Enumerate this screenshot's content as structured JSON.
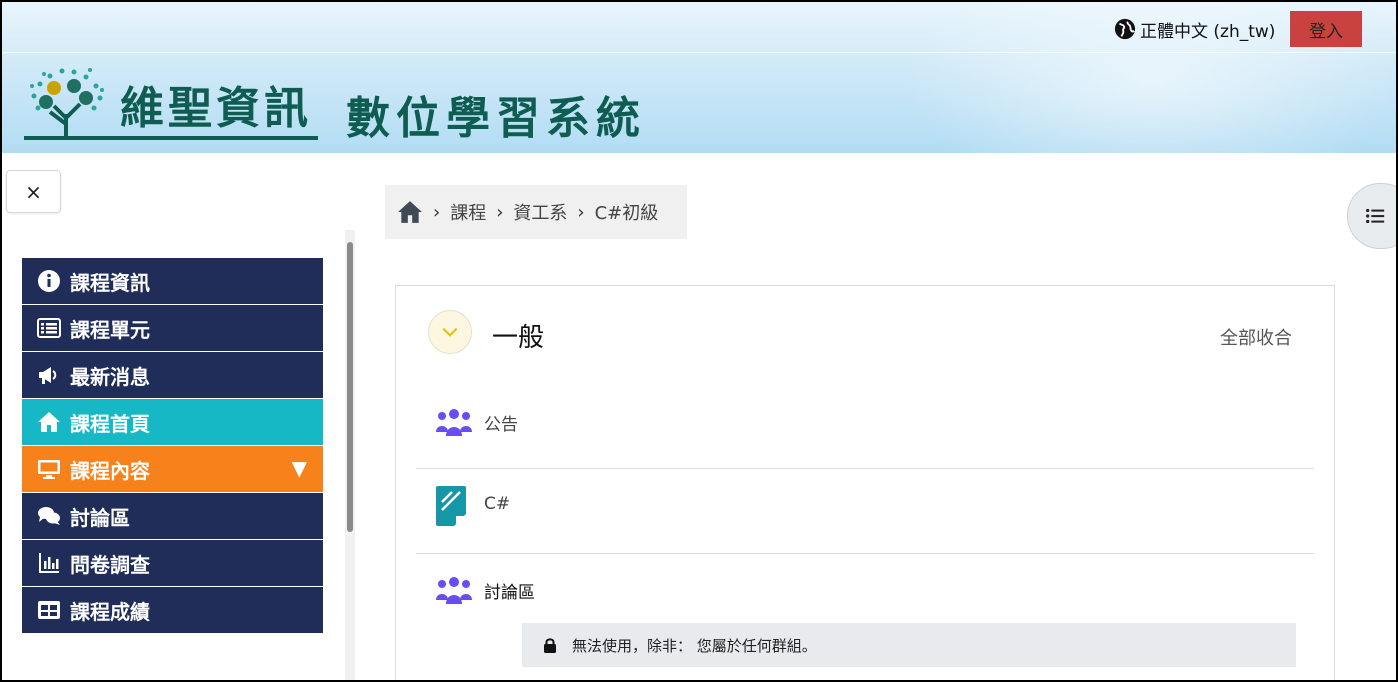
{
  "header": {
    "language_label": "正體中文 (zh_tw)",
    "login_label": "登入",
    "org_name": "維聖資訊",
    "system_title": "數位學習系統"
  },
  "close_button": {
    "label": "×"
  },
  "sidebar": {
    "items": [
      {
        "label": "課程資訊",
        "icon": "info-circle-icon"
      },
      {
        "label": "課程單元",
        "icon": "list-icon"
      },
      {
        "label": "最新消息",
        "icon": "megaphone-icon"
      },
      {
        "label": "課程首頁",
        "icon": "home-icon",
        "state": "active"
      },
      {
        "label": "課程內容",
        "icon": "monitor-icon",
        "state": "expanded",
        "caret": "▼"
      },
      {
        "label": "討論區",
        "icon": "comments-icon"
      },
      {
        "label": "問卷調查",
        "icon": "bar-chart-icon"
      },
      {
        "label": "課程成績",
        "icon": "table-icon"
      }
    ]
  },
  "breadcrumb": {
    "items": [
      "課程",
      "資工系",
      "C#初級"
    ]
  },
  "section": {
    "title": "一般",
    "collapse_all_label": "全部收合",
    "activities": [
      {
        "label": "公告",
        "icon": "forum-icon"
      },
      {
        "label": "C#",
        "icon": "page-icon"
      },
      {
        "label": "討論區",
        "icon": "forum-icon"
      }
    ],
    "restriction_text": "無法使用，除非： 您屬於任何群組。"
  },
  "colors": {
    "nav_bg": "#1f2d58",
    "nav_active": "#17b8c5",
    "nav_expanded": "#f7821b",
    "login_btn": "#c9423f",
    "brand_green": "#0f5d52",
    "forum_purple": "#6a4cf0",
    "page_teal": "#1597a7"
  }
}
